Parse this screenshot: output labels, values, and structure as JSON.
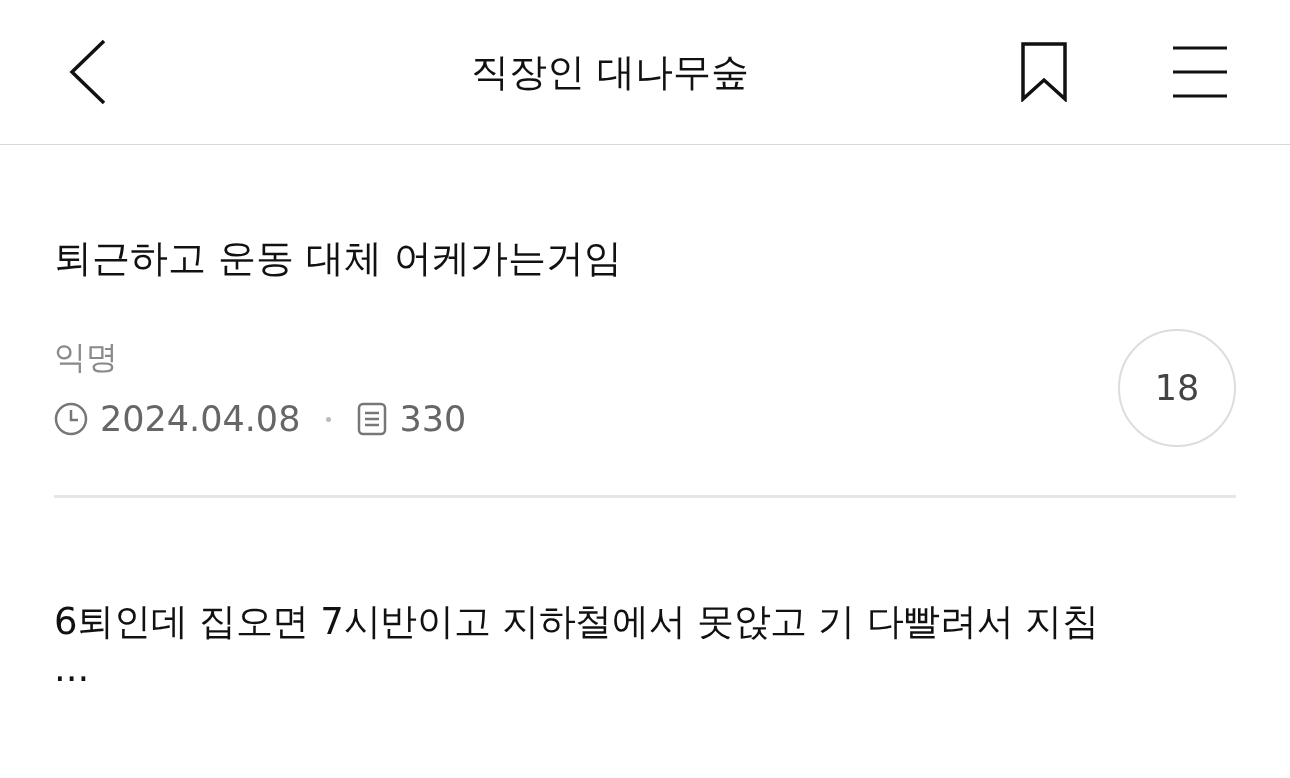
{
  "header": {
    "title": "직장인 대나무숲"
  },
  "post": {
    "title": "퇴근하고 운동 대체 어케가는거임",
    "author": "익명",
    "date": "2024.04.08",
    "views": "330",
    "comment_count": "18",
    "body": "6퇴인데 집오면 7시반이고 지하철에서 못앉고 기 다빨려서 지침",
    "ellipsis": "..."
  }
}
